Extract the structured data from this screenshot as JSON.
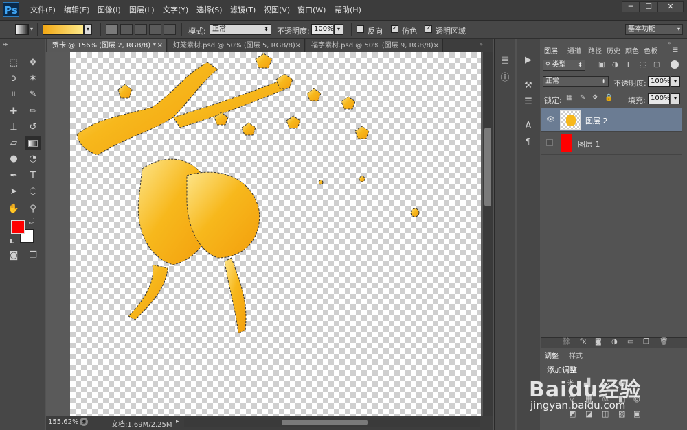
{
  "app": {
    "logo": "Ps",
    "window_buttons": [
      "─",
      "☐",
      "✕"
    ]
  },
  "menu": [
    "文件(F)",
    "编辑(E)",
    "图像(I)",
    "图层(L)",
    "文字(Y)",
    "选择(S)",
    "滤镜(T)",
    "视图(V)",
    "窗口(W)",
    "帮助(H)"
  ],
  "options": {
    "mode_label": "模式:",
    "mode_value": "正常",
    "opacity_label": "不透明度:",
    "opacity_value": "100%",
    "reverse_label": "反向",
    "dither_label": "仿色",
    "transparency_label": "透明区域",
    "workspace": "基本功能",
    "gradient_colors": [
      "#f2a814",
      "#fde98a"
    ]
  },
  "tabs": [
    {
      "label": "贺卡 @ 156% (图层 2, RGB/8) *",
      "close": "×"
    },
    {
      "label": "灯笼素材.psd @ 50% (图层 5, RGB/8)",
      "close": "×"
    },
    {
      "label": "福字素材.psd @ 50% (图层 9, RGB/8)",
      "close": "×"
    }
  ],
  "colors": {
    "foreground": "#ff0000",
    "background": "#ffffff",
    "selected_layer": "#6b7c93",
    "art_fill": "#f7b81c"
  },
  "status": {
    "zoom": "155.62%",
    "doc": "文档:1.69M/2.25M"
  },
  "layers_panel": {
    "tabs": [
      "图层",
      "通道",
      "路径",
      "历史",
      "颜色",
      "色板"
    ],
    "filter_label": "类型",
    "blend_mode": "正常",
    "opacity_label": "不透明度:",
    "opacity_value": "100%",
    "lock_label": "锁定:",
    "fill_label": "填充:",
    "fill_value": "100%",
    "layers": [
      {
        "name": "图层 2",
        "visible": true,
        "selected": true
      },
      {
        "name": "图层 1",
        "visible": false,
        "selected": false,
        "thumb": "#ff0000"
      }
    ]
  },
  "adjust_panel": {
    "tabs": [
      "调整",
      "样式"
    ],
    "add_label": "添加调整"
  },
  "watermark": {
    "brand": "Baidu经验",
    "url": "jingyan.baidu.com"
  }
}
